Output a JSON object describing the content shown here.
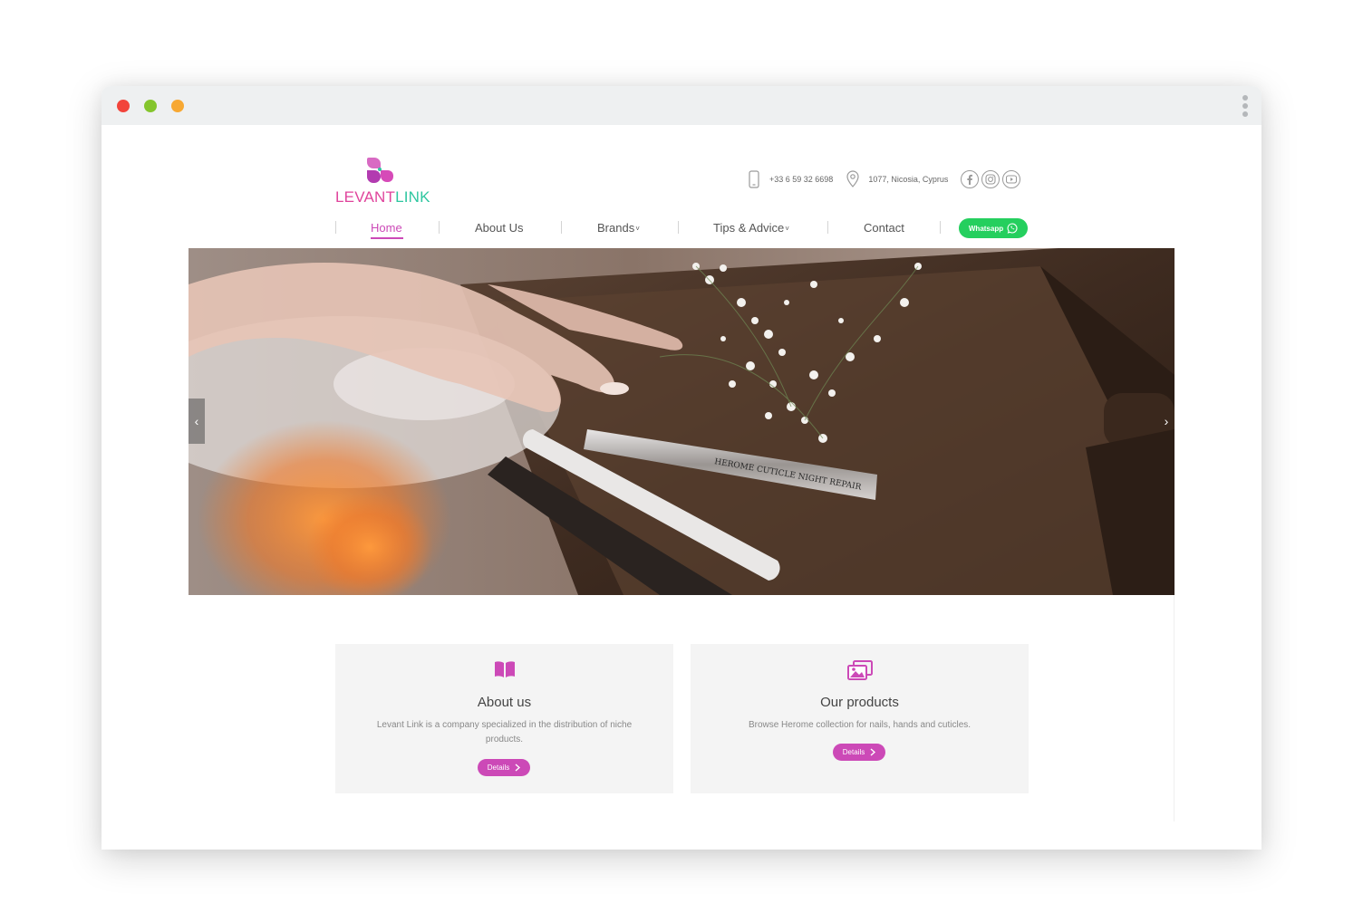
{
  "brand": {
    "name_part1": "LEVANT",
    "name_part2": "LINK",
    "pink": "#e0449c",
    "green": "#2fc6a0",
    "accent": "#cc49b7"
  },
  "header": {
    "phone": "+33 6 59 32 6698",
    "address": "1077, Nicosia, Cyprus",
    "phone_icon": "mobile-phone-icon",
    "location_icon": "map-pin-icon",
    "social_icons": [
      "facebook-icon",
      "instagram-icon",
      "youtube-icon"
    ]
  },
  "nav": {
    "items": [
      {
        "label": "Home",
        "active": true
      },
      {
        "label": "About Us"
      },
      {
        "label": "Brands"
      },
      {
        "label": "Tips & Advice"
      },
      {
        "label": "Contact"
      }
    ],
    "dropdown_caret": "˅",
    "whatsapp_label": "Whatsapp",
    "whatsapp_color": "#25cf5e"
  },
  "hero": {
    "prev_label": "‹",
    "next_label": "›",
    "product_text": "HEROME CUTICLE NIGHT REPAIR"
  },
  "cards": [
    {
      "icon": "open-book-icon",
      "title": "About us",
      "description": "Levant Link is a company specialized in the distribution of niche products.",
      "button": "Details"
    },
    {
      "icon": "images-gallery-icon",
      "title": "Our products",
      "description": "Browse Herome collection for nails, hands and cuticles.",
      "button": "Details"
    }
  ]
}
